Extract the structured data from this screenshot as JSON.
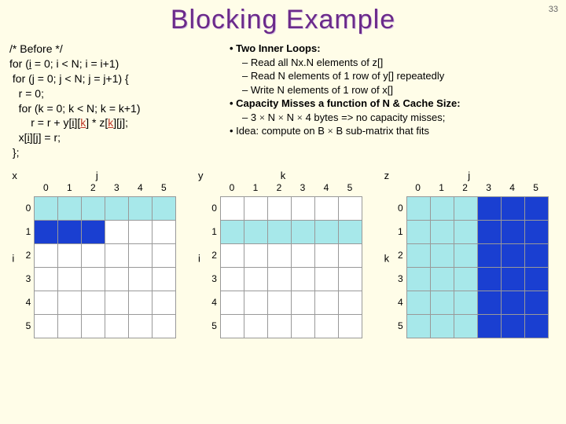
{
  "page_number": "33",
  "title": "Blocking Example",
  "code": {
    "l1": "/* Before */",
    "l2a": "for (",
    "l2b": "i",
    "l2c": " = 0; i < N; i = i+1)",
    "l3": " for (j = 0; j < N; j = j+1) {",
    "l4": "   r = 0;",
    "l5": "   for (k = 0; k < N; k = k+1)",
    "l6a": "       r = r + y[",
    "l6b": "i",
    "l6c": "][",
    "l6d": "k",
    "l6e": "] * z[",
    "l6f": "k",
    "l6g": "][",
    "l6h": "j",
    "l6i": "];",
    "l7a": "   x[",
    "l7b": "i",
    "l7c": "][",
    "l7d": "j",
    "l7e": "] = r;",
    "l8": " };"
  },
  "bullets": {
    "b1": "Two Inner Loops:",
    "b1a": "Read all Nx.N elements of z[]",
    "b1b": "Read N elements of 1 row of y[] repeatedly",
    "b1c": "Write N elements of 1 row  of x[]",
    "b2": "Capacity Misses a function of N & Cache Size:",
    "b2a_pre": "3 ",
    "b2a_mid1": " N ",
    "b2a_mid2": " N ",
    "b2a_post": " 4 bytes => no capacity misses;",
    "b3_pre": "Idea: compute on B ",
    "b3_post": " B sub-matrix that fits"
  },
  "times": "×",
  "grids": {
    "cols": [
      "0",
      "1",
      "2",
      "3",
      "4",
      "5"
    ],
    "rows": [
      "0",
      "1",
      "2",
      "3",
      "4",
      "5"
    ],
    "g": [
      {
        "corner": "x",
        "top": "j",
        "left": "i",
        "fill": [
          [
            "light",
            "light",
            "light",
            "light",
            "light",
            "light"
          ],
          [
            "dark",
            "dark",
            "dark",
            "",
            "",
            ""
          ],
          [
            "",
            "",
            "",
            "",
            "",
            ""
          ],
          [
            "",
            "",
            "",
            "",
            "",
            ""
          ],
          [
            "",
            "",
            "",
            "",
            "",
            ""
          ],
          [
            "",
            "",
            "",
            "",
            "",
            ""
          ]
        ]
      },
      {
        "corner": "y",
        "top": "k",
        "left": "i",
        "fill": [
          [
            "",
            "",
            "",
            "",
            "",
            ""
          ],
          [
            "light",
            "light",
            "light",
            "light",
            "light",
            "light"
          ],
          [
            "",
            "",
            "",
            "",
            "",
            ""
          ],
          [
            "",
            "",
            "",
            "",
            "",
            ""
          ],
          [
            "",
            "",
            "",
            "",
            "",
            ""
          ],
          [
            "",
            "",
            "",
            "",
            "",
            ""
          ]
        ]
      },
      {
        "corner": "z",
        "top": "j",
        "left": "k",
        "fill": [
          [
            "light",
            "light",
            "light",
            "dark",
            "dark",
            "dark"
          ],
          [
            "light",
            "light",
            "light",
            "dark",
            "dark",
            "dark"
          ],
          [
            "light",
            "light",
            "light",
            "dark",
            "dark",
            "dark"
          ],
          [
            "light",
            "light",
            "light",
            "dark",
            "dark",
            "dark"
          ],
          [
            "light",
            "light",
            "light",
            "dark",
            "dark",
            "dark"
          ],
          [
            "light",
            "light",
            "light",
            "dark",
            "dark",
            "dark"
          ]
        ]
      }
    ]
  }
}
